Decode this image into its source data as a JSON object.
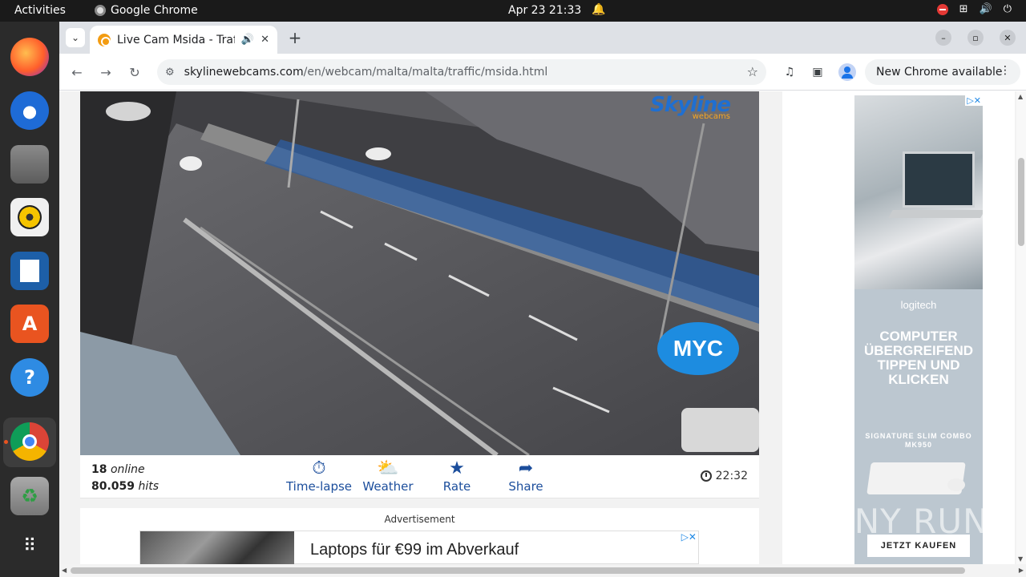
{
  "topbar": {
    "activities": "Activities",
    "app_name": "Google Chrome",
    "clock": "Apr 23  21:33"
  },
  "dock": {
    "items": [
      "firefox-icon",
      "thunderbird-icon",
      "files-icon",
      "rhythmbox-icon",
      "libreoffice-writer-icon",
      "app-center-icon",
      "help-icon",
      "chrome-icon",
      "trash-icon",
      "show-apps-icon"
    ]
  },
  "browser": {
    "tab_title": "Live Cam Msida - Traffi",
    "url_host": "skylinewebcams.com",
    "url_path": "/en/webcam/malta/malta/traffic/msida.html",
    "update_button": "New Chrome available"
  },
  "webcam": {
    "logo_text": "Skyline",
    "logo_sub": "webcams",
    "overlay_badge": "MYC",
    "online_count": "18",
    "online_label": "online",
    "hits_count": "80.059",
    "hits_label": "hits",
    "actions": [
      {
        "label": "Time-lapse",
        "icon": "timelapse-icon"
      },
      {
        "label": "Weather",
        "icon": "weather-icon"
      },
      {
        "label": "Rate",
        "icon": "star-icon"
      },
      {
        "label": "Share",
        "icon": "share-icon"
      }
    ],
    "local_time": "22:32"
  },
  "ads": {
    "bottom_label": "Advertisement",
    "bottom_banner_text": "Laptops für €99 im Abverkauf",
    "side_brand": "logitech",
    "side_headline": "COMPUTER ÜBERGREIFEND TIPPEN UND KLICKEN",
    "side_product": "SIGNATURE SLIM COMBO MK950",
    "side_cta": "JETZT KAUFEN"
  },
  "watermark": "ANY RUN",
  "colors": {
    "accent_blue": "#1c4e9c",
    "ad_background": "#bcc7d0",
    "myc_badge": "#1d8ce0"
  }
}
